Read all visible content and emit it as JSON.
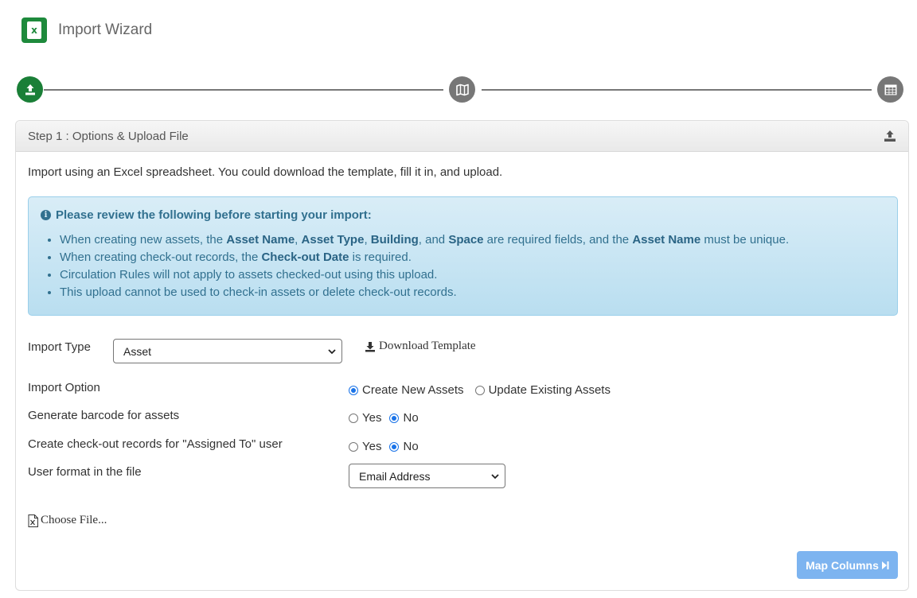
{
  "app": {
    "title": "Import Wizard",
    "logo_glyph": "x",
    "brand_color": "#1e8a3c"
  },
  "stepper": {
    "steps": [
      {
        "icon": "upload-icon",
        "state": "active"
      },
      {
        "icon": "map-icon",
        "state": "inactive"
      },
      {
        "icon": "table-icon",
        "state": "inactive"
      }
    ]
  },
  "panel": {
    "title": "Step 1 : Options & Upload File",
    "intro": "Import using an Excel spreadsheet. You could download the template, fill it in, and upload."
  },
  "alert": {
    "title": "Please review the following before starting your import:",
    "items": [
      {
        "parts": [
          "When creating new assets, the ",
          "Asset Name",
          ", ",
          "Asset Type",
          ", ",
          "Building",
          ", and ",
          "Space",
          " are required fields, and the ",
          "Asset Name",
          " must be unique."
        ]
      },
      {
        "parts": [
          "When creating check-out records, the ",
          "Check-out Date",
          " is required."
        ]
      },
      {
        "parts": [
          "Circulation Rules will not apply to assets checked-out using this upload."
        ]
      },
      {
        "parts": [
          "This upload cannot be used to check-in assets or delete check-out records."
        ]
      }
    ]
  },
  "form": {
    "import_type": {
      "label": "Import Type",
      "value": "Asset"
    },
    "download_template": "Download Template",
    "import_option": {
      "label": "Import Option",
      "options": [
        "Create New Assets",
        "Update Existing Assets"
      ],
      "selected": "Create New Assets"
    },
    "barcode": {
      "label": "Generate barcode for assets",
      "options": [
        "Yes",
        "No"
      ],
      "selected": "No"
    },
    "checkout": {
      "label": "Create check-out records for \"Assigned To\" user",
      "options": [
        "Yes",
        "No"
      ],
      "selected": "No"
    },
    "user_format": {
      "label": "User format in the file",
      "value": "Email Address"
    },
    "choose_file": "Choose File...",
    "map_columns": "Map Columns"
  }
}
